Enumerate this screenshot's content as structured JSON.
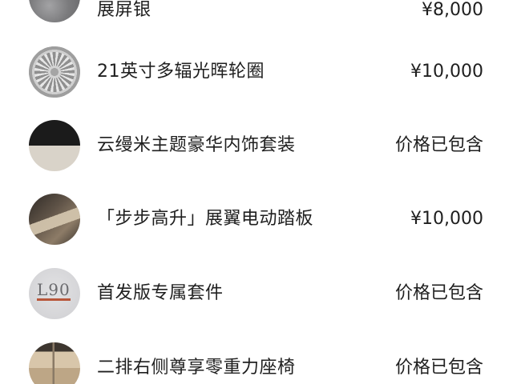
{
  "items": [
    {
      "name": "展屏银",
      "price": "¥8,000",
      "icon": "silver-paint-swatch"
    },
    {
      "name": "21英寸多辐光晖轮圈",
      "price": "¥10,000",
      "icon": "wheel-rim-image"
    },
    {
      "name": "云缦米主题豪华内饰套装",
      "price": "价格已包含",
      "icon": "interior-swatch"
    },
    {
      "name": "「步步高升」展翼电动踏板",
      "price": "¥10,000",
      "icon": "side-step-image"
    },
    {
      "name": "首发版专属套件",
      "price": "价格已包含",
      "icon": "badge-image",
      "badge_text": "L90"
    },
    {
      "name": "二排右侧尊享零重力座椅",
      "price": "价格已包含",
      "icon": "seat-image"
    }
  ]
}
